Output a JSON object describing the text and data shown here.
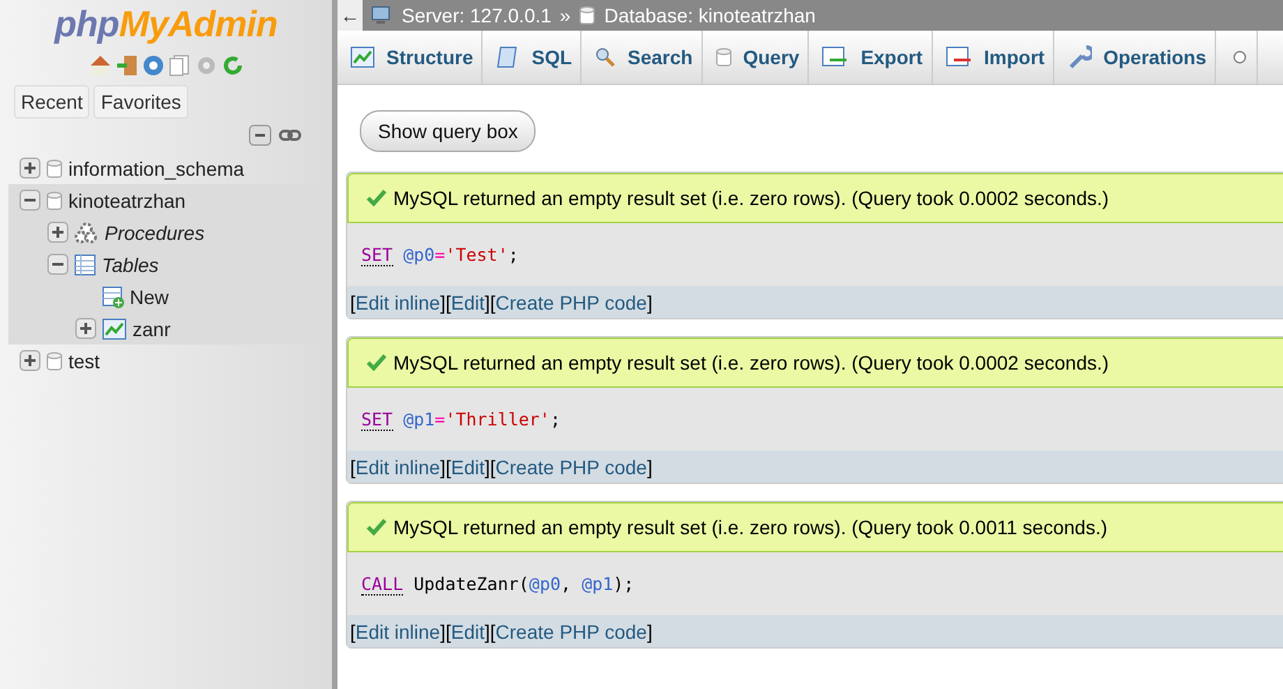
{
  "sidebar": {
    "logo": {
      "part_1": "php",
      "part_2": "MyAdmin"
    },
    "tabs": [
      {
        "label": "Recent"
      },
      {
        "label": "Favorites"
      }
    ],
    "tree": [
      {
        "label": "information_schema",
        "kind": "database",
        "expanded": false,
        "highlighted": false
      },
      {
        "label": "kinoteatrzhan",
        "kind": "database",
        "expanded": true,
        "highlighted": true,
        "children": [
          {
            "label": "Procedures",
            "kind": "group",
            "expanded": false
          },
          {
            "label": "Tables",
            "kind": "group",
            "expanded": true,
            "children": [
              {
                "label": "New",
                "kind": "new"
              },
              {
                "label": "zanr",
                "kind": "table",
                "expanded": false
              }
            ]
          }
        ]
      },
      {
        "label": "test",
        "kind": "database",
        "expanded": false,
        "highlighted": false
      }
    ]
  },
  "breadcrumb": {
    "back": "←",
    "server": "Server: 127.0.0.1",
    "separator": "»",
    "database": "Database: kinoteatrzhan"
  },
  "tabs": [
    {
      "label": "Structure",
      "selected": false
    },
    {
      "label": "SQL",
      "selected": false
    },
    {
      "label": "Search",
      "selected": false
    },
    {
      "label": "Query",
      "selected": false
    },
    {
      "label": "Export",
      "selected": false
    },
    {
      "label": "Import",
      "selected": false
    },
    {
      "label": "Operations",
      "selected": false
    }
  ],
  "show_query_box": "Show query box",
  "results": [
    {
      "message": "MySQL returned an empty result set (i.e. zero rows). (Query took 0.0002 seconds.)",
      "sql": [
        {
          "kind": "keyword",
          "text": "SET"
        },
        {
          "kind": "variable",
          "text": "@p0"
        },
        {
          "kind": "operator",
          "text": "="
        },
        {
          "kind": "string",
          "text": "'Test'"
        },
        {
          "kind": "plain",
          "text": ";"
        }
      ],
      "links": [
        {
          "open": "[",
          "label": "Edit inline",
          "close": "]"
        },
        {
          "open": "[",
          "label": "Edit",
          "close": "]"
        },
        {
          "open": "[",
          "label": "Create PHP code",
          "close": "]"
        }
      ]
    },
    {
      "message": "MySQL returned an empty result set (i.e. zero rows). (Query took 0.0002 seconds.)",
      "sql": [
        {
          "kind": "keyword",
          "text": "SET"
        },
        {
          "kind": "variable",
          "text": "@p1"
        },
        {
          "kind": "operator",
          "text": "="
        },
        {
          "kind": "string",
          "text": "'Thriller'"
        },
        {
          "kind": "plain",
          "text": ";"
        }
      ],
      "links": [
        {
          "open": "[",
          "label": "Edit inline",
          "close": "]"
        },
        {
          "open": "[",
          "label": "Edit",
          "close": "]"
        },
        {
          "open": "[",
          "label": "Create PHP code",
          "close": "]"
        }
      ]
    },
    {
      "message": "MySQL returned an empty result set (i.e. zero rows). (Query took 0.0011 seconds.)",
      "sql": [
        {
          "kind": "keyword",
          "text": "CALL"
        },
        {
          "kind": "plain",
          "text": "UpdateZanr("
        },
        {
          "kind": "variable",
          "text": "@p0"
        },
        {
          "kind": "plain",
          "text": ", "
        },
        {
          "kind": "variable",
          "text": "@p1"
        },
        {
          "kind": "plain",
          "text": ");"
        }
      ],
      "links": [
        {
          "open": "[",
          "label": "Edit inline",
          "close": "]"
        },
        {
          "open": "[",
          "label": "Edit",
          "close": "]"
        },
        {
          "open": "[",
          "label": "Create PHP code",
          "close": "]"
        }
      ]
    }
  ]
}
